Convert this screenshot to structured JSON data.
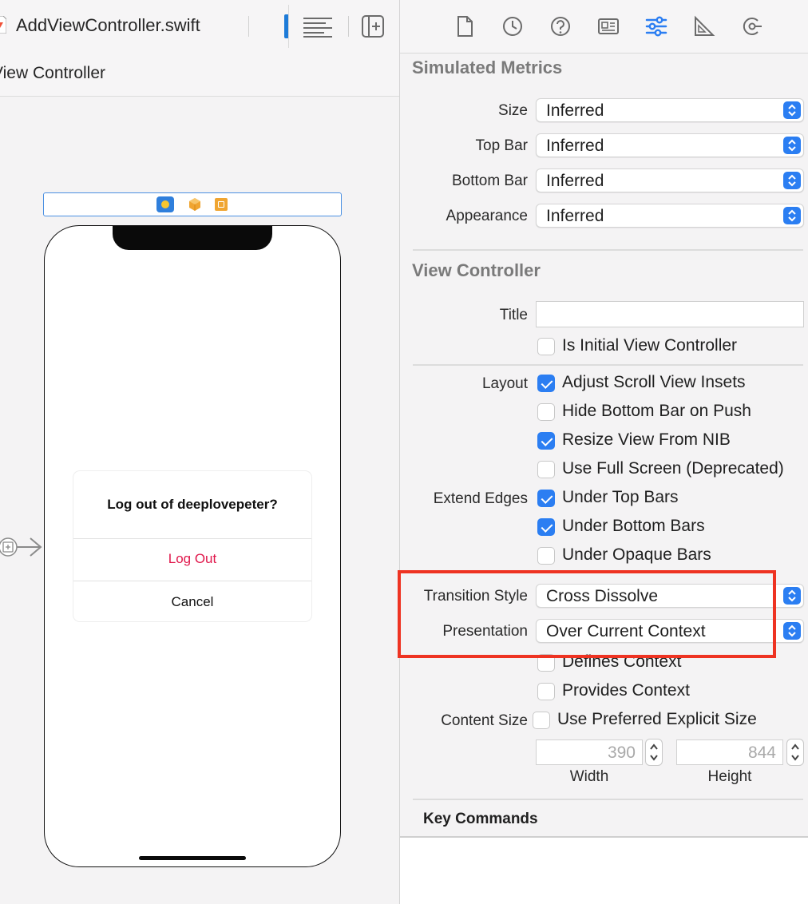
{
  "editor": {
    "file_tab": "AddViewController.swift",
    "scene_title": "View Controller"
  },
  "alert": {
    "title": "Log out of deeplovepeter?",
    "destructive_action": "Log Out",
    "cancel_action": "Cancel"
  },
  "inspector": {
    "tabs": [
      "file-icon",
      "history-icon",
      "help-icon",
      "identity-icon",
      "attributes-icon",
      "size-icon",
      "connections-icon"
    ],
    "simulated_metrics": {
      "title": "Simulated Metrics",
      "size": {
        "label": "Size",
        "value": "Inferred"
      },
      "top_bar": {
        "label": "Top Bar",
        "value": "Inferred"
      },
      "bottom_bar": {
        "label": "Bottom Bar",
        "value": "Inferred"
      },
      "appearance": {
        "label": "Appearance",
        "value": "Inferred"
      }
    },
    "view_controller": {
      "title": "View Controller",
      "title_label": "Title",
      "title_value": "",
      "is_initial": {
        "label": "Is Initial View Controller",
        "checked": false
      },
      "layout_label": "Layout",
      "adjust_scroll": {
        "label": "Adjust Scroll View Insets",
        "checked": true
      },
      "hide_bottom_bar": {
        "label": "Hide Bottom Bar on Push",
        "checked": false
      },
      "resize_from_nib": {
        "label": "Resize View From NIB",
        "checked": true
      },
      "full_screen": {
        "label": "Use Full Screen (Deprecated)",
        "checked": false
      },
      "extend_edges_label": "Extend Edges",
      "under_top": {
        "label": "Under Top Bars",
        "checked": true
      },
      "under_bottom": {
        "label": "Under Bottom Bars",
        "checked": true
      },
      "under_opaque": {
        "label": "Under Opaque Bars",
        "checked": false
      },
      "transition_style": {
        "label": "Transition Style",
        "value": "Cross Dissolve"
      },
      "presentation": {
        "label": "Presentation",
        "value": "Over Current Context"
      },
      "defines_context": {
        "label": "Defines Context",
        "checked": false
      },
      "provides_context": {
        "label": "Provides Context",
        "checked": false
      },
      "content_size_label": "Content Size",
      "preferred_size": {
        "label": "Use Preferred Explicit Size",
        "checked": false
      },
      "width": {
        "label": "Width",
        "value": "390"
      },
      "height": {
        "label": "Height",
        "value": "844"
      }
    },
    "key_commands": {
      "title": "Key Commands"
    }
  },
  "colors": {
    "accent": "#2b7ef2",
    "highlight": "#ee3322",
    "destructive": "#e0174b"
  }
}
